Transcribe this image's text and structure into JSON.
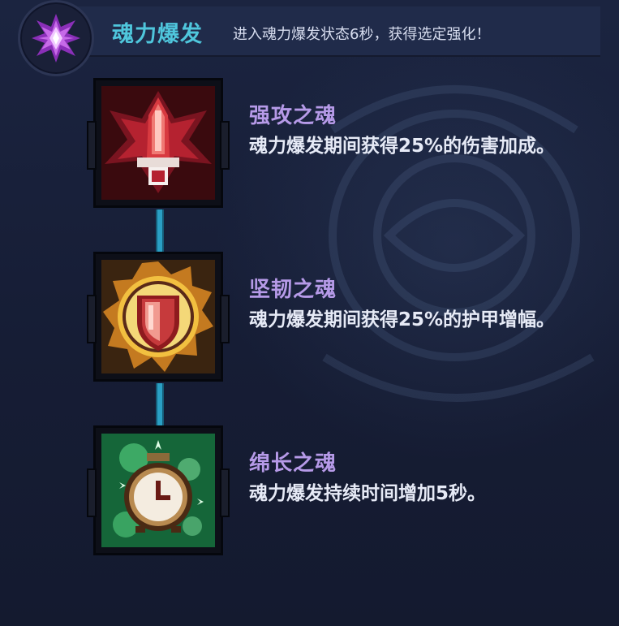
{
  "header": {
    "title": "魂力爆发",
    "description": "进入魂力爆发状态6秒，获得选定强化！",
    "emblem_icon": "purple-soul-crystal-icon"
  },
  "skills": [
    {
      "name": "强攻之魂",
      "description": "魂力爆发期间获得25%的伤害加成。",
      "icon": "red-flame-sword-icon"
    },
    {
      "name": "坚韧之魂",
      "description": "魂力爆发期间获得25%的护甲增幅。",
      "icon": "golden-shield-icon"
    },
    {
      "name": "绵长之魂",
      "description": "魂力爆发持续时间增加5秒。",
      "icon": "green-clock-icon"
    }
  ],
  "colors": {
    "title": "#4fc6dc",
    "skill_name": "#b69ae8",
    "connector": "#2a9fc4"
  }
}
